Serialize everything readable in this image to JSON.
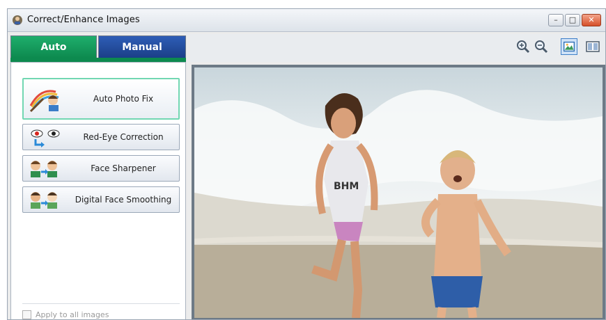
{
  "window": {
    "title": "Correct/Enhance Images",
    "buttons": {
      "minimize": "–",
      "maximize": "□",
      "close": "✕"
    }
  },
  "tabs": [
    {
      "label": "Auto",
      "active": true
    },
    {
      "label": "Manual",
      "active": false
    }
  ],
  "fixes": [
    {
      "label": "Auto Photo Fix",
      "icon": "auto-photo-fix-icon",
      "active": true
    },
    {
      "label": "Red-Eye Correction",
      "icon": "red-eye-icon",
      "active": false
    },
    {
      "label": "Face Sharpener",
      "icon": "face-sharpener-icon",
      "active": false
    },
    {
      "label": "Digital Face Smoothing",
      "icon": "face-smoothing-icon",
      "active": false
    }
  ],
  "apply_all": {
    "label": "Apply to all images",
    "checked": false
  },
  "toolbar": {
    "icons": [
      "zoom-in-icon",
      "zoom-out-icon",
      "fit-view-icon",
      "compare-view-icon"
    ]
  },
  "colors": {
    "auto_tab": "#0d8a4f",
    "manual_tab": "#1b3f88",
    "active_outline": "#72d7b2"
  }
}
